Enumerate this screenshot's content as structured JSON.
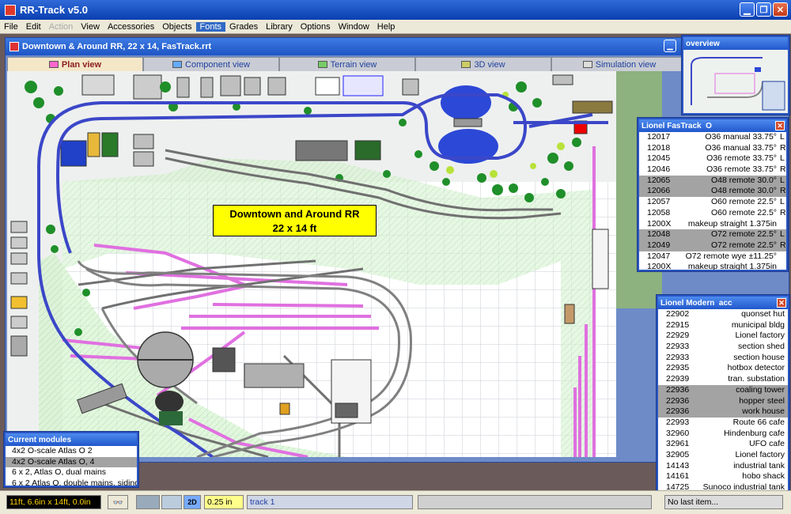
{
  "window": {
    "title": "RR-Track v5.0"
  },
  "menu": [
    "File",
    "Edit",
    "Action",
    "View",
    "Accessories",
    "Objects",
    "Fonts",
    "Grades",
    "Library",
    "Options",
    "Window",
    "Help"
  ],
  "menu_disabled": "Action",
  "menu_active": "Fonts",
  "document": {
    "title": "Downtown & Around RR, 22 x 14, FasTrack.rrt"
  },
  "tabs": [
    "Plan view",
    "Component view",
    "Terrain view",
    "3D view",
    "Simulation view"
  ],
  "active_tab": "Plan view",
  "layout_label": {
    "line1": "Downtown and Around RR",
    "line2": "22 x 14 ft"
  },
  "overview": {
    "title": "overview"
  },
  "fastrack": {
    "title": "Lionel FasTrack",
    "title_suffix": "O",
    "rows": [
      {
        "code": "12017",
        "desc": "O36 manual 33.75°",
        "tail": "L",
        "sel": false
      },
      {
        "code": "12018",
        "desc": "O36 manual 33.75°",
        "tail": "R",
        "sel": false
      },
      {
        "code": "12045",
        "desc": "O36 remote 33.75°",
        "tail": "L",
        "sel": false
      },
      {
        "code": "12046",
        "desc": "O36 remote 33.75°",
        "tail": "R",
        "sel": false
      },
      {
        "code": "12065",
        "desc": "O48 remote 30.0°",
        "tail": "L",
        "sel": true
      },
      {
        "code": "12066",
        "desc": "O48 remote 30.0°",
        "tail": "R",
        "sel": true
      },
      {
        "code": "12057",
        "desc": "O60 remote 22.5°",
        "tail": "L",
        "sel": false
      },
      {
        "code": "12058",
        "desc": "O60 remote 22.5°",
        "tail": "R",
        "sel": false
      },
      {
        "code": "1200X",
        "desc": "makeup straight  1.375in",
        "tail": "",
        "sel": false
      },
      {
        "code": "12048",
        "desc": "O72 remote 22.5°",
        "tail": "L",
        "sel": true
      },
      {
        "code": "12049",
        "desc": "O72 remote 22.5°",
        "tail": "R",
        "sel": true
      },
      {
        "code": "12047",
        "desc": "O72 remote wye  ±11.25°",
        "tail": "",
        "sel": false
      },
      {
        "code": "1200X",
        "desc": "makeup straight  1.375in",
        "tail": "",
        "sel": false
      }
    ]
  },
  "modern": {
    "title": "Lionel Modern",
    "title_suffix": "acc",
    "rows": [
      {
        "code": "22902",
        "desc": "quonset hut",
        "sel": false
      },
      {
        "code": "22915",
        "desc": "municipal bldg",
        "sel": false
      },
      {
        "code": "22929",
        "desc": "Lionel factory",
        "sel": false
      },
      {
        "code": "22933",
        "desc": "section shed",
        "sel": false
      },
      {
        "code": "22933",
        "desc": "section house",
        "sel": false
      },
      {
        "code": "22935",
        "desc": "hotbox detector",
        "sel": false
      },
      {
        "code": "22939",
        "desc": "tran. substation",
        "sel": false
      },
      {
        "code": "22936",
        "desc": "coaling tower",
        "sel": true
      },
      {
        "code": "22936",
        "desc": "hopper steel",
        "sel": true
      },
      {
        "code": "22936",
        "desc": "work house",
        "sel": true
      },
      {
        "code": "22993",
        "desc": "Route 66 cafe",
        "sel": false
      },
      {
        "code": "32960",
        "desc": "Hindenburg cafe",
        "sel": false
      },
      {
        "code": "32961",
        "desc": "UFO cafe",
        "sel": false
      },
      {
        "code": "32905",
        "desc": "Lionel factory",
        "sel": false
      },
      {
        "code": "14143",
        "desc": "industrial tank",
        "sel": false
      },
      {
        "code": "14161",
        "desc": "hobo shack",
        "sel": false
      },
      {
        "code": "14725",
        "desc": "Sunoco industrial tank",
        "sel": false
      }
    ]
  },
  "modules": {
    "title": "Current modules",
    "rows": [
      {
        "label": "4x2 O-scale Atlas O 2",
        "sel": false
      },
      {
        "label": "4x2 O-scale Atlas O, 4",
        "sel": true
      },
      {
        "label": "6 x 2, Atlas O, dual mains",
        "sel": false
      },
      {
        "label": "6 x 2 Atlas O, double mains, siding",
        "sel": false
      }
    ]
  },
  "status": {
    "dimensions": "11ft, 6.6in x 14ft, 0.0in",
    "grid": "0.25 in",
    "track": "track 1",
    "last_item": "No last item..."
  },
  "colors": {
    "mainline": "#3b47c8",
    "siding": "#e070e0",
    "track_gray": "#707070",
    "label_bg": "#ffff00",
    "grass": "#c8efc0",
    "tree": "#1f8f2a"
  }
}
